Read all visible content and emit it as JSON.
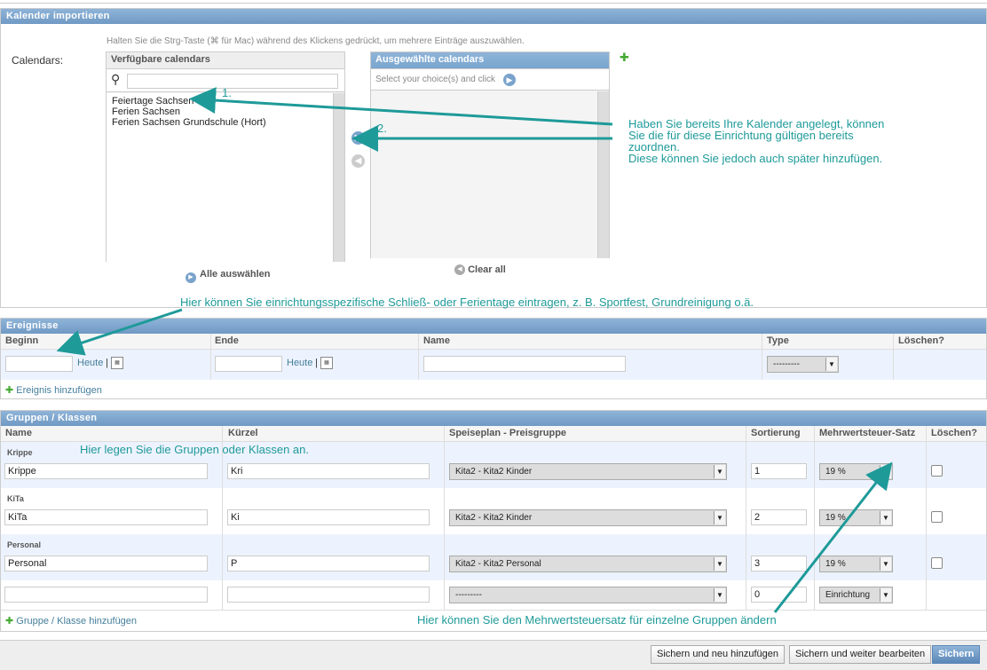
{
  "calendar_module": {
    "title": "Kalender importieren",
    "help": "Halten Sie die Strg-Taste (⌘ für Mac) während des Klickens gedrückt, um mehrere Einträge auszuwählen.",
    "field_label": "Calendars:",
    "available_title": "Verfügbare calendars",
    "available_items": [
      "Feiertage Sachsen",
      "Ferien Sachsen",
      "Ferien Sachsen Grundschule (Hort)"
    ],
    "chosen_title": "Ausgewählte calendars",
    "chosen_hint": "Select your choice(s) and click",
    "select_all": "Alle auswählen",
    "clear_all": "Clear all",
    "add_icon": "plus-icon"
  },
  "annotations": {
    "step1": "1.",
    "step2": "2.",
    "calendar_note": [
      "Haben Sie bereits Ihre Kalender angelegt, können",
      "Sie die für diese Einrichtung gültigen bereits",
      "zuordnen.",
      "Diese können Sie jedoch auch später hinzufügen."
    ],
    "events_note": "Hier können Sie einrichtungsspezifische Schließ- oder Ferientage eintragen, z. B. Sportfest, Grundreinigung o.ä.",
    "groups_note": "Hier legen Sie die Gruppen oder Klassen an.",
    "tax_note": "Hier können Sie den Mehrwertsteuersatz für einzelne Gruppen ändern"
  },
  "events_module": {
    "title": "Ereignisse",
    "columns": [
      "Beginn",
      "Ende",
      "Name",
      "Type",
      "Löschen?"
    ],
    "today": "Heute",
    "separator": "|",
    "type_value": "---------",
    "add_label": "Ereignis hinzufügen"
  },
  "groups_module": {
    "title": "Gruppen / Klassen",
    "columns": [
      "Name",
      "Kürzel",
      "Speiseplan - Preisgruppe",
      "Sortierung",
      "Mehrwertsteuer-Satz",
      "Löschen?"
    ],
    "rows": [
      {
        "label": "Krippe",
        "name": "Krippe",
        "code": "Kri",
        "price_group": "Kita2 - Kita2 Kinder",
        "sort": "1",
        "tax": "19 %"
      },
      {
        "label": "KiTa",
        "name": "KiTa",
        "code": "Ki",
        "price_group": "Kita2 - Kita2 Kinder",
        "sort": "2",
        "tax": "19 %"
      },
      {
        "label": "Personal",
        "name": "Personal",
        "code": "P",
        "price_group": "Kita2 - Kita2 Personal",
        "sort": "3",
        "tax": "19 %"
      },
      {
        "label": "",
        "name": "",
        "code": "",
        "price_group": "---------",
        "sort": "0",
        "tax": "Einrichtung"
      }
    ],
    "add_label": "Gruppe / Klasse hinzufügen"
  },
  "submit_row": {
    "save_add": "Sichern und neu hinzufügen",
    "save_continue": "Sichern und weiter bearbeiten",
    "save": "Sichern"
  },
  "colors": {
    "accent": "#1e9a99",
    "header": "#7aa3cc",
    "link": "#447e9b"
  }
}
